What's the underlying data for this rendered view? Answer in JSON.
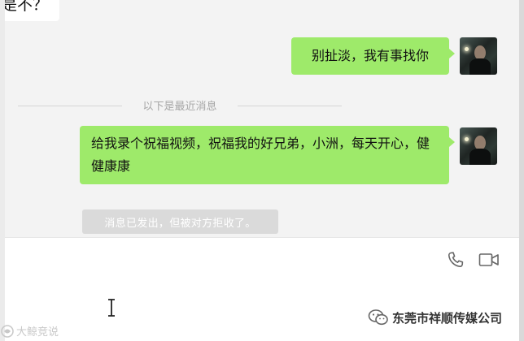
{
  "chat": {
    "partial_incoming_text": "是不？",
    "messages": [
      {
        "sender": "self",
        "text": "别扯淡，我有事找你"
      },
      {
        "sender": "self",
        "text": "给我录个祝福视频，祝福我的好兄弟，小洲，每天开心，健健康康"
      }
    ],
    "divider_label": "以下是最近消息",
    "system_notice": "消息已发出，但被对方拒收了。"
  },
  "toolbar": {
    "icons": [
      "phone-icon",
      "video-call-icon"
    ]
  },
  "watermarks": {
    "left": "大鲸竞说",
    "right": "东莞市祥顺传媒公司"
  },
  "colors": {
    "outgoing_bubble": "#9eea6a",
    "chat_background": "#f3f3f3",
    "notice_background": "#dadada"
  }
}
